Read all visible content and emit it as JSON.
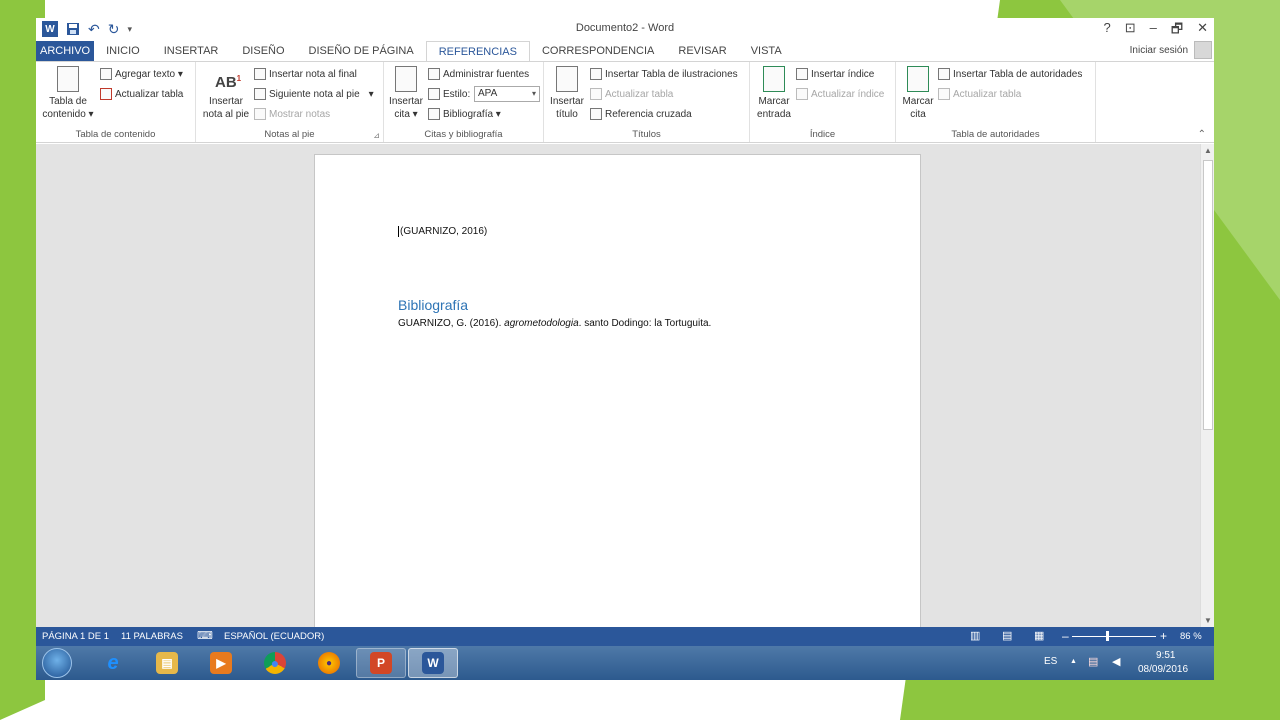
{
  "colors": {
    "word_blue": "#2b579a",
    "slide_green": "#8dc63f",
    "heading_blue": "#2e74b5"
  },
  "titlebar": {
    "title": "Documento2 - Word",
    "app_icon": "W",
    "undo_glyph": "↶",
    "redo_glyph": "↻",
    "save_icon": "save-icon",
    "help": "?",
    "ribbon_opts": "⊡",
    "minimize": "–",
    "restore": "🗗",
    "close": "✕"
  },
  "tabs": [
    "ARCHIVO",
    "INICIO",
    "INSERTAR",
    "DISEÑO",
    "DISEÑO DE PÁGINA",
    "REFERENCIAS",
    "CORRESPONDENCIA",
    "REVISAR",
    "VISTA"
  ],
  "active_tab": "REFERENCIAS",
  "signin": "Iniciar sesión",
  "ribbon": {
    "toc": {
      "label": "Tabla de contenido",
      "big": "Tabla de contenido ▾",
      "add_text": "Agregar texto ▾",
      "update": "Actualizar tabla"
    },
    "footnotes": {
      "label": "Notas al pie",
      "big": "Insertar nota al pie",
      "endnote": "Insertar nota al final",
      "next": "Siguiente nota al pie",
      "next_dd": "▾",
      "show": "Mostrar notas",
      "launcher": "⊿"
    },
    "citations": {
      "label": "Citas y bibliografía",
      "big": "Insertar cita ▾",
      "manage": "Administrar fuentes",
      "style_label": "Estilo:",
      "style_value": "APA",
      "bib": "Bibliografía ▾"
    },
    "captions": {
      "label": "Títulos",
      "big": "Insertar título",
      "insert_tof": "Insertar Tabla de ilustraciones",
      "update": "Actualizar tabla",
      "crossref": "Referencia cruzada"
    },
    "index": {
      "label": "Índice",
      "big": "Marcar entrada",
      "insert": "Insertar índice",
      "update": "Actualizar índice"
    },
    "toa": {
      "label": "Tabla de autoridades",
      "big": "Marcar cita",
      "insert": "Insertar Tabla de autoridades",
      "update": "Actualizar tabla"
    },
    "collapse": "⌃"
  },
  "document": {
    "citation": "(GUARNIZO, 2016)",
    "bib_heading": "Bibliografía",
    "bib_entry_author": "GUARNIZO, G. (2016). ",
    "bib_entry_title": "agrometodologia",
    "bib_entry_rest": ". santo Dodingo: la Tortuguita."
  },
  "statusbar": {
    "page": "PÁGINA 1 DE 1",
    "words": "11 PALABRAS",
    "language": "ESPAÑOL (ECUADOR)",
    "zoom_minus": "–",
    "zoom_plus": "+",
    "zoom": "86 %"
  },
  "taskbar": {
    "items": [
      {
        "name": "internet-explorer",
        "glyph": "e",
        "color": "#1e90ff"
      },
      {
        "name": "file-explorer",
        "glyph": "▤",
        "color": "#e6b84a"
      },
      {
        "name": "media-player",
        "glyph": "▶",
        "color": "#e87a1e"
      },
      {
        "name": "chrome",
        "glyph": "●",
        "color": "#db4437"
      },
      {
        "name": "firefox",
        "glyph": "●",
        "color": "#e66000"
      },
      {
        "name": "powerpoint",
        "glyph": "P",
        "color": "#d24726"
      },
      {
        "name": "word",
        "glyph": "W",
        "color": "#2b579a"
      }
    ],
    "lang": "ES",
    "tray_arrow": "▲",
    "time": "9:51",
    "date": "08/09/2016"
  }
}
